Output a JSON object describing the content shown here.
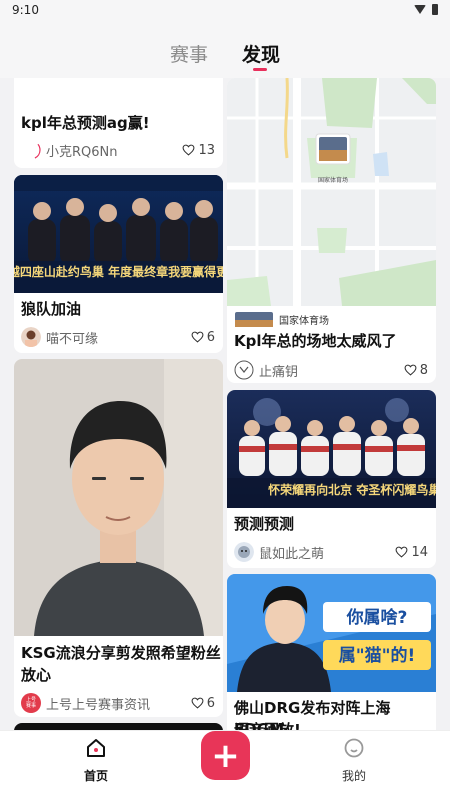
{
  "status_bar": {
    "time": "9:10"
  },
  "tabs": {
    "events": "赛事",
    "discover": "发现"
  },
  "left_column": [
    {
      "title": "kpl年总预测ag赢!",
      "author": "小克RQ6Nn",
      "likes": "13"
    },
    {
      "title": "狼队加油",
      "author": "喵不可缘",
      "likes": "6",
      "image_caption": "翱越四座山赴约鸟巢 年度最终章我要赢得更响"
    },
    {
      "title_line1": "KSG流浪分享剪发照希望粉丝",
      "title_line2": "放心",
      "author": "上号上号赛事资讯",
      "likes": "6",
      "avatar_text": "上号 赛事"
    }
  ],
  "right_column": [
    {
      "venue_tag": "国家体育场",
      "map_label": "国家体育场",
      "title": "Kpl年总的场地太威风了",
      "author": "止痛钥",
      "likes": "8"
    },
    {
      "title": "预测预测",
      "author": "鼠如此之萌",
      "likes": "14",
      "image_caption": "怀荣耀再向北京 夺圣杯闪耀鸟巢!"
    },
    {
      "title_line1": "佛山DRG发布对阵上海EDGM",
      "title_line2": "语音回放!",
      "image_text_1": "你属啥?",
      "image_text_2": "属\"猫\"的!"
    }
  ],
  "bottom_nav": {
    "home": "首页",
    "me": "我的",
    "add": "+"
  },
  "colors": {
    "accent": "#e83558",
    "background": "#f2f2f4"
  },
  "icons": [
    "wifi-icon",
    "battery-icon",
    "heart-icon",
    "home-icon",
    "add-icon",
    "profile-icon"
  ]
}
